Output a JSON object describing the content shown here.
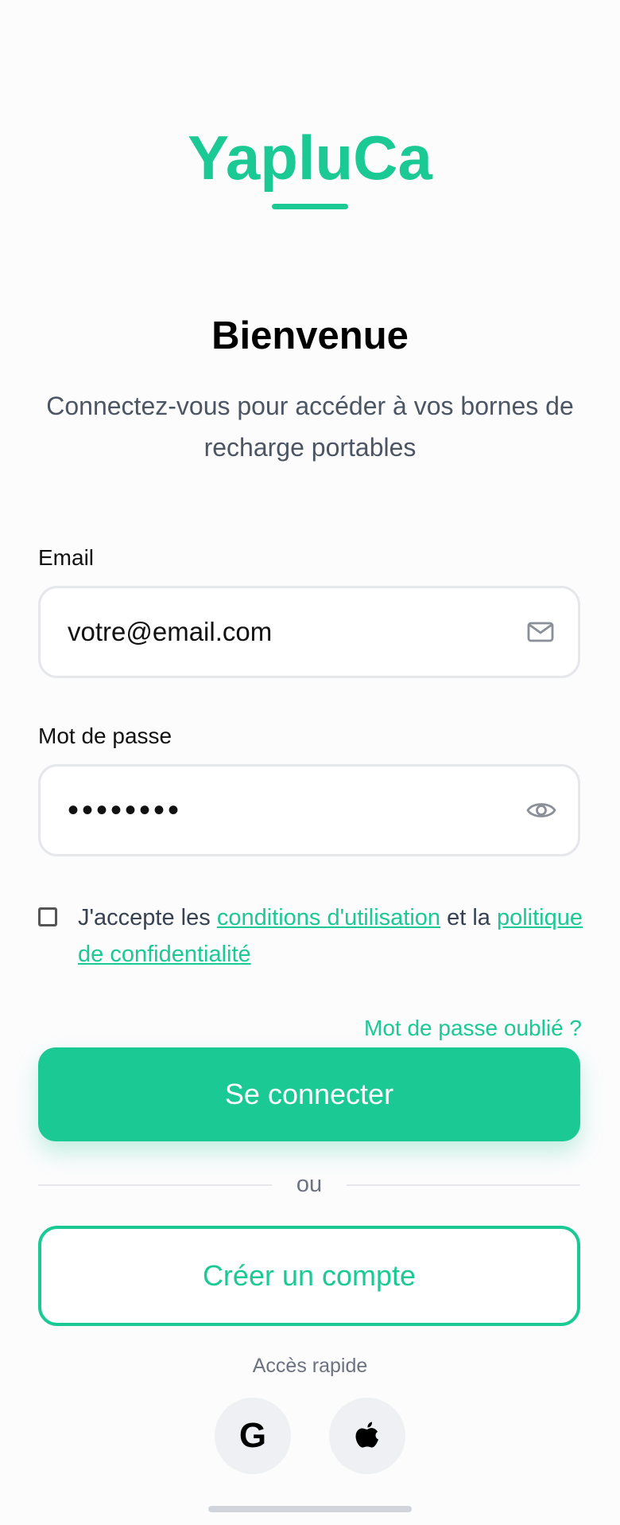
{
  "brand": {
    "name": "YapluCa",
    "accent_color": "#1bc995"
  },
  "header": {
    "title": "Bienvenue",
    "subtitle": "Connectez-vous pour accéder à vos bornes de recharge portables"
  },
  "form": {
    "email": {
      "label": "Email",
      "value": "votre@email.com",
      "icon": "mail-icon"
    },
    "password": {
      "label": "Mot de passe",
      "value": "••••••••",
      "icon": "eye-icon"
    },
    "terms": {
      "checked": false,
      "prefix": "J'accepte les",
      "terms_link": "conditions d'utilisation",
      "middle": "et la",
      "privacy_link": "politique de confidentialité"
    },
    "forgot_password": "Mot de passe oublié ?",
    "submit_label": "Se connecter"
  },
  "divider": {
    "text": "ou"
  },
  "create_account_label": "Créer un compte",
  "quick_access": {
    "label": "Accès rapide",
    "providers": [
      {
        "name": "google",
        "glyph": "G",
        "icon": "google-icon"
      },
      {
        "name": "apple",
        "icon": "apple-icon"
      }
    ]
  }
}
